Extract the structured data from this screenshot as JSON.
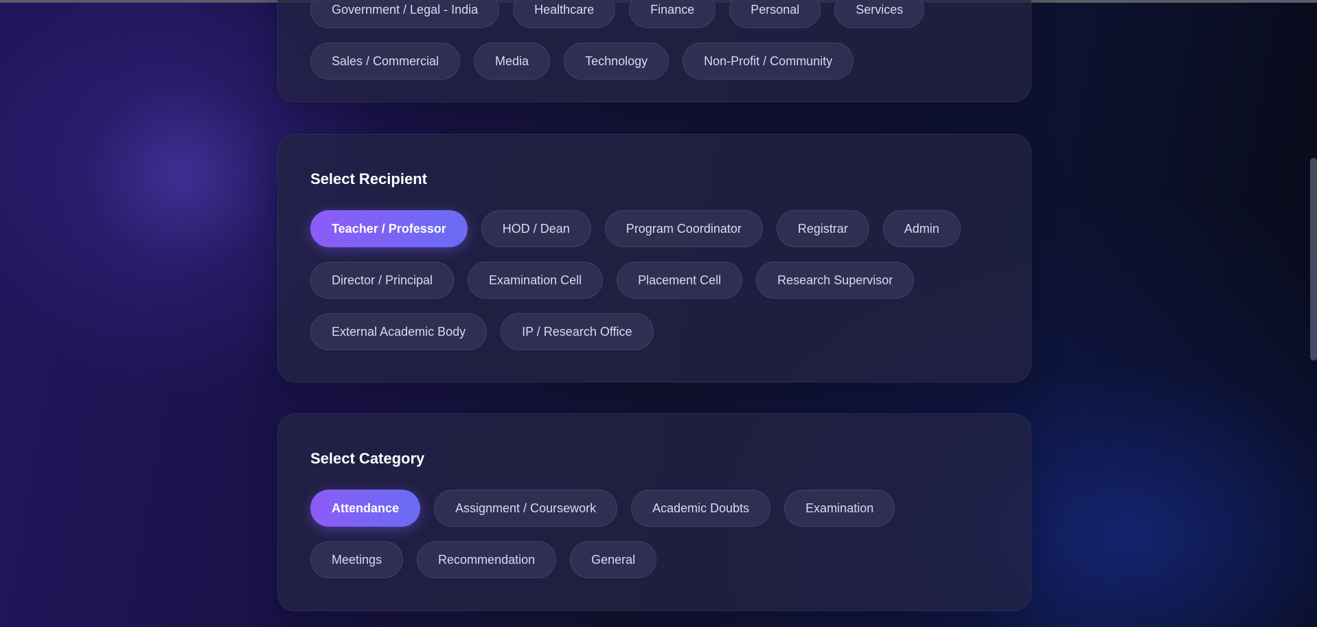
{
  "industry": {
    "partial_row": [
      "Government / Legal - India",
      "Healthcare",
      "Finance",
      "Personal",
      "Services"
    ],
    "row": [
      "Sales / Commercial",
      "Media",
      "Technology",
      "Non-Profit / Community"
    ]
  },
  "recipient": {
    "title": "Select Recipient",
    "options": [
      "Teacher / Professor",
      "HOD / Dean",
      "Program Coordinator",
      "Registrar",
      "Admin",
      "Director / Principal",
      "Examination Cell",
      "Placement Cell",
      "Research Supervisor",
      "External Academic Body",
      "IP / Research Office"
    ],
    "selected": "Teacher / Professor"
  },
  "category": {
    "title": "Select Category",
    "options": [
      "Attendance",
      "Assignment / Coursework",
      "Academic Doubts",
      "Examination",
      "Meetings",
      "Recommendation",
      "General"
    ],
    "selected": "Attendance"
  },
  "colors": {
    "accent_start": "#8c5cf6",
    "accent_end": "#6a6cf4"
  }
}
